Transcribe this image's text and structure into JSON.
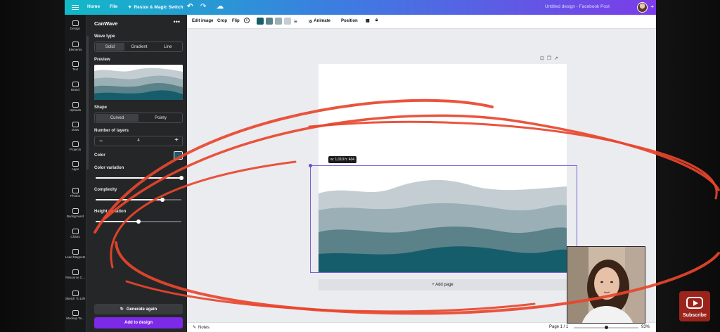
{
  "topbar": {
    "home": "Home",
    "file": "File",
    "resize": "Resize & Magic Switch",
    "title": "Untitled design - Facebook Post"
  },
  "rail": {
    "items": [
      {
        "label": "Design",
        "icon": "layout-icon"
      },
      {
        "label": "Elements",
        "icon": "shapes-icon"
      },
      {
        "label": "Text",
        "icon": "text-icon"
      },
      {
        "label": "Brand",
        "icon": "brand-icon"
      },
      {
        "label": "Uploads",
        "icon": "cloud-upload-icon"
      },
      {
        "label": "Draw",
        "icon": "pen-icon"
      },
      {
        "label": "Projects",
        "icon": "folder-icon"
      },
      {
        "label": "Apps",
        "icon": "apps-icon"
      },
      {
        "label": "Photos",
        "icon": "photo-icon"
      },
      {
        "label": "Background",
        "icon": "background-icon"
      },
      {
        "label": "Charts",
        "icon": "chart-icon"
      },
      {
        "label": "Lead Magnets",
        "icon": "magnet-icon"
      },
      {
        "label": "Resource C...",
        "icon": "resource-icon"
      },
      {
        "label": "Sketch To Life",
        "icon": "sketch-icon"
      },
      {
        "label": "Mockup Te...",
        "icon": "mockup-icon"
      }
    ]
  },
  "panel": {
    "title": "CanWave",
    "wave_type_label": "Wave type",
    "wave_types": [
      "Solid",
      "Gradient",
      "Line"
    ],
    "preview_label": "Preview",
    "shape_label": "Shape",
    "shapes": [
      "Curved",
      "Pointy"
    ],
    "layers_label": "Number of layers",
    "layers_value": "4",
    "color_label": "Color",
    "color_variation_label": "Color variation",
    "complexity_label": "Complexity",
    "height_variation_label": "Height variation",
    "sliders": {
      "color_variation": 1.0,
      "complexity": 0.78,
      "height_variation": 0.5
    },
    "generate_label": "Generate again",
    "add_label": "Add to design"
  },
  "toolbar": {
    "edit_image": "Edit image",
    "crop": "Crop",
    "flip": "Flip",
    "animate": "Animate",
    "position": "Position"
  },
  "canvas": {
    "size_badge": "w: 1,010 h: 404",
    "add_page": "+ Add page"
  },
  "bottombar": {
    "notes": "Notes",
    "page": "Page 1 / 1",
    "zoom": "93%"
  },
  "subscribe": "Subscribe",
  "colors": {
    "wave1": "#c4ced2",
    "wave2": "#9aafb6",
    "wave3": "#5b8189",
    "wave4": "#165d6c",
    "accent": "#7d2ae8",
    "scribble": "#e8452c"
  }
}
